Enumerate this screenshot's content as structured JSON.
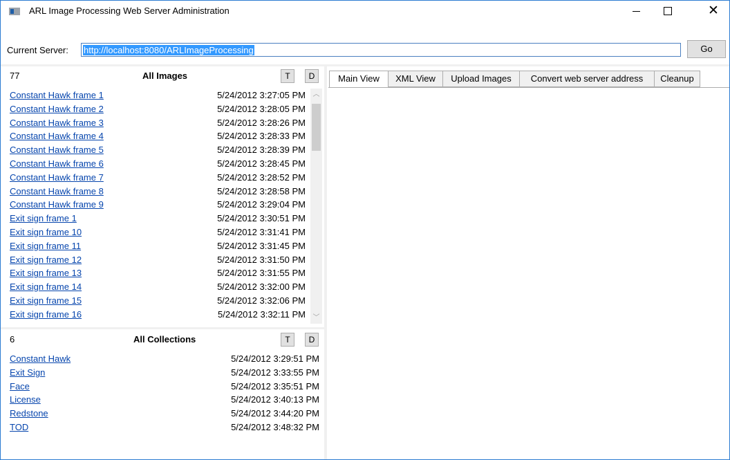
{
  "window": {
    "title": "ARL Image Processing Web Server Administration"
  },
  "server": {
    "label": "Current Server:",
    "url": "http://localhost:8080/ARLImageProcessing",
    "go_label": "Go"
  },
  "images_panel": {
    "count": "77",
    "title": "All Images",
    "t_label": "T",
    "d_label": "D",
    "items": [
      {
        "name": "Constant Hawk frame 1",
        "date": "5/24/2012 3:27:05 PM"
      },
      {
        "name": "Constant Hawk frame 2",
        "date": "5/24/2012 3:28:05 PM"
      },
      {
        "name": "Constant Hawk frame 3",
        "date": "5/24/2012 3:28:26 PM"
      },
      {
        "name": "Constant Hawk frame 4",
        "date": "5/24/2012 3:28:33 PM"
      },
      {
        "name": "Constant Hawk frame 5",
        "date": "5/24/2012 3:28:39 PM"
      },
      {
        "name": "Constant Hawk frame 6",
        "date": "5/24/2012 3:28:45 PM"
      },
      {
        "name": "Constant Hawk frame 7",
        "date": "5/24/2012 3:28:52 PM"
      },
      {
        "name": "Constant Hawk frame 8",
        "date": "5/24/2012 3:28:58 PM"
      },
      {
        "name": "Constant Hawk frame 9",
        "date": "5/24/2012 3:29:04 PM"
      },
      {
        "name": "Exit sign frame 1",
        "date": "5/24/2012 3:30:51 PM"
      },
      {
        "name": "Exit sign frame 10",
        "date": "5/24/2012 3:31:41 PM"
      },
      {
        "name": "Exit sign frame 11",
        "date": "5/24/2012 3:31:45 PM"
      },
      {
        "name": "Exit sign frame 12",
        "date": "5/24/2012 3:31:50 PM"
      },
      {
        "name": "Exit sign frame 13",
        "date": "5/24/2012 3:31:55 PM"
      },
      {
        "name": "Exit sign frame 14",
        "date": "5/24/2012 3:32:00 PM"
      },
      {
        "name": "Exit sign frame 15",
        "date": "5/24/2012 3:32:06 PM"
      },
      {
        "name": "Exit sign frame 16",
        "date": "5/24/2012 3:32:11 PM"
      }
    ],
    "scrollbar": {
      "up_icon": "chevron-up-icon",
      "down_icon": "chevron-down-icon"
    }
  },
  "collections_panel": {
    "count": "6",
    "title": "All Collections",
    "t_label": "T",
    "d_label": "D",
    "items": [
      {
        "name": "Constant Hawk",
        "date": "5/24/2012 3:29:51 PM"
      },
      {
        "name": "Exit Sign",
        "date": "5/24/2012 3:33:55 PM"
      },
      {
        "name": "Face",
        "date": "5/24/2012 3:35:51 PM"
      },
      {
        "name": "License",
        "date": "5/24/2012 3:40:13 PM"
      },
      {
        "name": "Redstone",
        "date": "5/24/2012 3:44:20 PM"
      },
      {
        "name": "TOD",
        "date": "5/24/2012 3:48:32 PM"
      }
    ]
  },
  "tabs": [
    {
      "label": "Main View",
      "active": true
    },
    {
      "label": "XML View",
      "active": false
    },
    {
      "label": "Upload Images",
      "active": false
    },
    {
      "label": "Convert web server address",
      "active": false
    },
    {
      "label": "Cleanup",
      "active": false
    }
  ],
  "colors": {
    "link": "#0645ad",
    "selection": "#3399ff",
    "window_border": "#2b7bd1"
  }
}
